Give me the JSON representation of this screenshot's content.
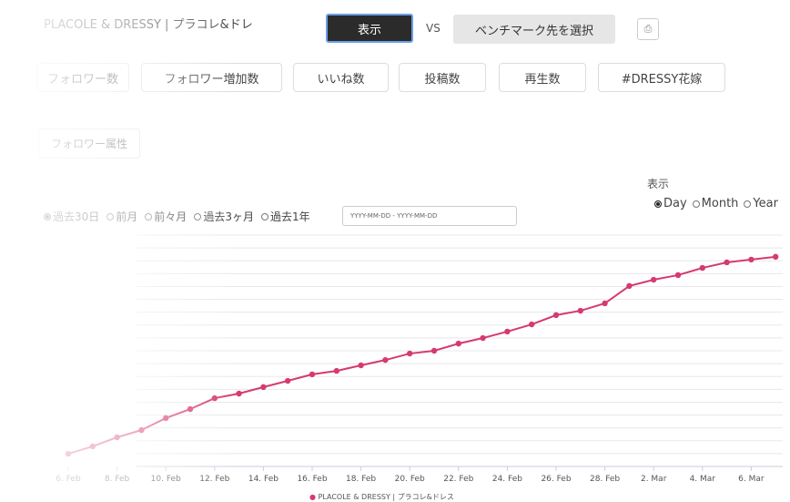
{
  "header": {
    "account_title": "PLACOLE & DRESSY | プラコレ&ドレ",
    "show_button": "表示",
    "vs": "VS",
    "benchmark_button": "ベンチマーク先を選択",
    "pdf_icon": "pdf-icon"
  },
  "tabs": [
    {
      "label": "フォロワー数"
    },
    {
      "label": "フォロワー増加数"
    },
    {
      "label": "いいね数"
    },
    {
      "label": "投稿数"
    },
    {
      "label": "再生数"
    },
    {
      "label": "#DRESSY花嫁"
    }
  ],
  "attribute_button": "フォロワー属性",
  "period": {
    "options": [
      "過去30日",
      "前月",
      "前々月",
      "過去3ヶ月",
      "過去1年"
    ],
    "selected": "過去30日",
    "date_placeholder": "YYYY-MM-DD - YYYY-MM-DD"
  },
  "view": {
    "label": "表示",
    "options": [
      "Day",
      "Month",
      "Year"
    ],
    "selected": "Day"
  },
  "colors": {
    "series": "#d63a72",
    "grid": "#e8e8ee"
  },
  "chart_data": {
    "type": "line",
    "x": [
      "6. Feb",
      "7. Feb",
      "8. Feb",
      "9. Feb",
      "10. Feb",
      "11. Feb",
      "12. Feb",
      "13. Feb",
      "14. Feb",
      "15. Feb",
      "16. Feb",
      "17. Feb",
      "18. Feb",
      "19. Feb",
      "20. Feb",
      "21. Feb",
      "22. Feb",
      "23. Feb",
      "24. Feb",
      "25. Feb",
      "26. Feb",
      "27. Feb",
      "28. Feb",
      "1. Mar",
      "2. Mar",
      "3. Mar",
      "4. Mar",
      "5. Mar",
      "6. Mar",
      "7. Mar"
    ],
    "tick_labels": [
      "6. Feb",
      "8. Feb",
      "10. Feb",
      "12. Feb",
      "14. Feb",
      "16. Feb",
      "18. Feb",
      "20. Feb",
      "22. Feb",
      "24. Feb",
      "26. Feb",
      "28. Feb",
      "2. Mar",
      "4. Mar",
      "6. Mar"
    ],
    "series": [
      {
        "name": "PLACOLE & DRESSY | プラコレ&ドレス",
        "values": [
          5.5,
          8.7,
          12.6,
          15.7,
          20.9,
          24.8,
          29.5,
          31.5,
          34.3,
          37,
          39.8,
          41.3,
          43.7,
          46,
          48.8,
          50,
          53.1,
          55.5,
          58.3,
          61.4,
          65.4,
          67.3,
          70.5,
          78,
          80.7,
          82.7,
          85.8,
          88.2,
          89.4,
          90.6
        ]
      }
    ],
    "ylim": [
      0,
      100
    ],
    "grid": true,
    "legend": "bottom"
  }
}
